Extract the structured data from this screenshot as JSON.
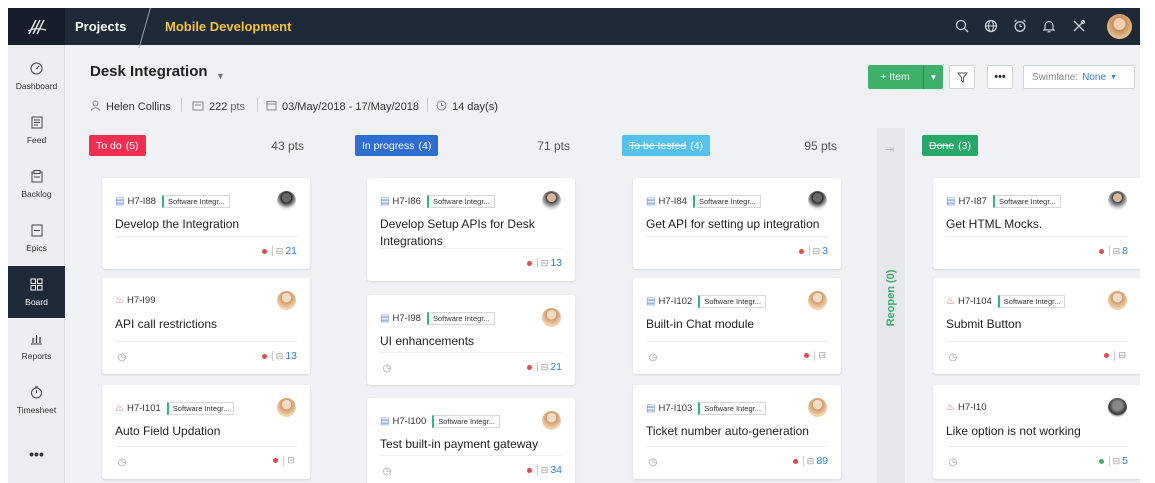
{
  "topbar": {
    "breadcrumb_projects": "Projects",
    "breadcrumb_project": "Mobile Development",
    "icons": [
      "search-icon",
      "globe-icon",
      "alarm-icon",
      "bell-icon",
      "tools-icon",
      "avatar"
    ]
  },
  "sidebar": {
    "items": [
      {
        "label": "Dashboard",
        "icon": "gauge-icon"
      },
      {
        "label": "Feed",
        "icon": "feed-icon"
      },
      {
        "label": "Backlog",
        "icon": "backlog-icon"
      },
      {
        "label": "Epics",
        "icon": "epics-icon"
      },
      {
        "label": "Board",
        "icon": "board-icon"
      },
      {
        "label": "Reports",
        "icon": "reports-icon"
      },
      {
        "label": "Timesheet",
        "icon": "timer-icon"
      },
      {
        "label": "•••",
        "icon": "more-icon"
      }
    ]
  },
  "header": {
    "title": "Desk Integration",
    "owner": "Helen Collins",
    "points": "222",
    "points_unit": "pts",
    "date_range": "03/May/2018 - 17/May/2018",
    "duration": "14 day(s)"
  },
  "toolbar": {
    "add_item_label": "+ Item",
    "more_label": "•••",
    "swimlane_label": "Swimlane:",
    "swimlane_value": "None"
  },
  "colors": {
    "todo": "#ee2f52",
    "in_progress": "#2f6ed0",
    "to_be_tested": "#56c1ec",
    "done": "#28a868",
    "accent": "#3fb06a"
  },
  "columns": [
    {
      "name": "To do",
      "count": "(5)",
      "points": "43 pts"
    },
    {
      "name": "In progress",
      "count": "(4)",
      "points": "71 pts"
    },
    {
      "name": "To be tested",
      "count": "(4)",
      "points": "95 pts"
    },
    {
      "name": "Done",
      "count": "(3)",
      "points": ""
    }
  ],
  "reopen": {
    "label": "Reopen (0)"
  },
  "project_tag": "Software Integr...",
  "cards": [
    {
      "id": "H7-I88",
      "title": "Develop the Integration",
      "count": "21",
      "has_tag": true
    },
    {
      "id": "H7-I99",
      "title": "API call restrictions",
      "count": "13",
      "has_tag": false
    },
    {
      "id": "H7-I101",
      "title": "Auto Field Updation",
      "count": "",
      "has_tag": true
    },
    {
      "id": "H7-I86",
      "title": "Develop Setup APIs for Desk Integrations",
      "count": "13",
      "has_tag": true
    },
    {
      "id": "H7-I98",
      "title": "UI enhancements",
      "count": "21",
      "has_tag": true
    },
    {
      "id": "H7-I100",
      "title": "Test built-in payment gateway",
      "count": "34",
      "has_tag": true
    },
    {
      "id": "H7-I84",
      "title": "Get API for setting up integration",
      "count": "3",
      "has_tag": true
    },
    {
      "id": "H7-I102",
      "title": "Built-in Chat module",
      "count": "",
      "has_tag": true
    },
    {
      "id": "H7-I103",
      "title": "Ticket number auto-generation",
      "count": "89",
      "has_tag": true
    },
    {
      "id": "H7-I87",
      "title": "Get HTML Mocks.",
      "count": "8",
      "has_tag": true
    },
    {
      "id": "H7-I104",
      "title": "Submit Button",
      "count": "",
      "has_tag": true
    },
    {
      "id": "H7-I10",
      "title": "Like option is not working",
      "count": "5",
      "has_tag": false
    }
  ]
}
